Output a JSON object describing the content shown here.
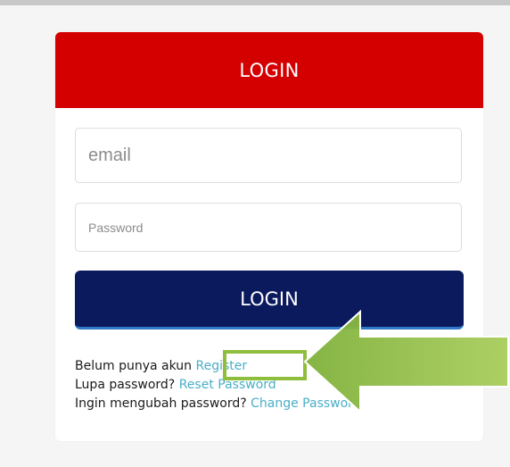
{
  "login_card": {
    "header_title": "LOGIN",
    "email": {
      "placeholder": "email",
      "value": ""
    },
    "password": {
      "placeholder": "Password",
      "value": ""
    },
    "submit_label": "LOGIN",
    "colors": {
      "header": "#d40000",
      "button": "#0a1a5c",
      "link": "#4aaec8"
    }
  },
  "links": {
    "register_prompt": "Belum punya akun",
    "register_link": "Register",
    "forgot_prompt": "Lupa password?",
    "reset_link": "Reset Password",
    "change_prompt": "Ingin mengubah password?",
    "change_link": "Change Password"
  },
  "annotation": {
    "highlight_color": "#8fbd3c",
    "arrow_color": "#8cb83d",
    "arrow_icon": "arrow-left-icon"
  }
}
